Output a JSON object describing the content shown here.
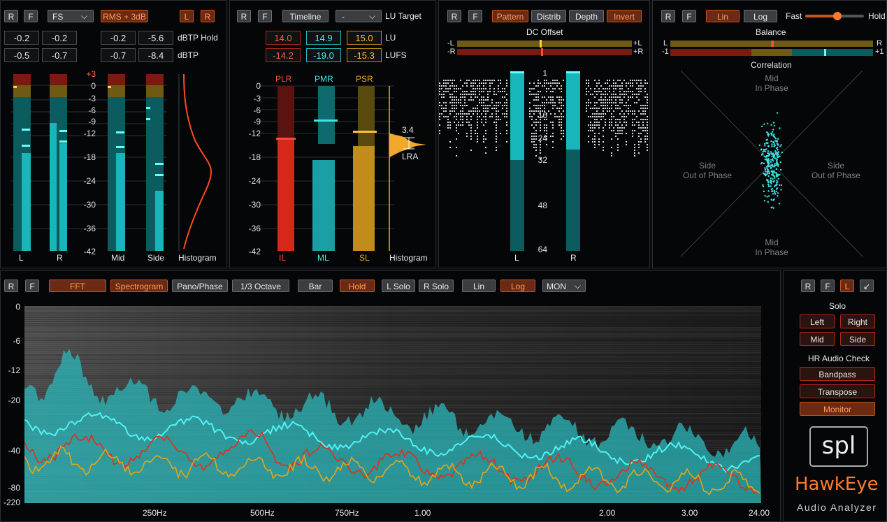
{
  "colors": {
    "accent": "#c4561f",
    "cyan": "#3fe5e6",
    "red": "#d7261a",
    "yellow": "#d69a14"
  },
  "p1": {
    "btn_r": "R",
    "btn_f": "F",
    "mode": "FS",
    "rms": "RMS + 3dB",
    "btn_l": "L",
    "btn_r2": "R",
    "hold_values": [
      "-0.2",
      "-0.2",
      "-0.2",
      "-5.6"
    ],
    "hold_label": "dBTP Hold",
    "dbtp_values": [
      "-0.5",
      "-0.7",
      "-0.7",
      "-8.4"
    ],
    "dbtp_label": "dBTP",
    "scale": [
      "+3",
      "0",
      "-3",
      "-6",
      "-9",
      "-12",
      "-18",
      "-24",
      "-30",
      "-36",
      "-42"
    ],
    "ch": [
      "L",
      "R",
      "Mid",
      "Side"
    ],
    "histogram": "Histogram"
  },
  "p2": {
    "btn_r": "R",
    "btn_f": "F",
    "timeline": "Timeline",
    "dash": "-",
    "lu_target": "LU Target",
    "lu_values": [
      "14.0",
      "14.9",
      "15.0"
    ],
    "lu_label": "LU",
    "lufs_values": [
      "-14.2",
      "-19.0",
      "-15.3"
    ],
    "lufs_label": "LUFS",
    "heads": [
      "PLR",
      "PMR",
      "PSR"
    ],
    "feet": [
      "IL",
      "ML",
      "SL"
    ],
    "scale": [
      "0",
      "-3",
      "-6",
      "-9",
      "-12",
      "-18",
      "-24",
      "-30",
      "-36",
      "-42"
    ],
    "lra_value": "3.4",
    "lra_label": "LRA",
    "histogram": "Histogram"
  },
  "p3": {
    "btn_r": "R",
    "btn_f": "F",
    "pattern": "Pattern",
    "distrib": "Distrib",
    "depth": "Depth",
    "invert": "Invert",
    "dc_title": "DC Offset",
    "dc_l": "-L",
    "dc_r": "-R",
    "dc_pl": "+L",
    "dc_pr": "+R",
    "scale": [
      "1",
      "16",
      "24",
      "32",
      "48",
      "64"
    ],
    "ch": [
      "L",
      "R"
    ]
  },
  "p4": {
    "btn_r": "R",
    "btn_f": "F",
    "lin": "Lin",
    "log": "Log",
    "fast": "Fast",
    "hold": "Hold",
    "slider_level": 0.55,
    "balance": "Balance",
    "bal_l": "L",
    "bal_r": "R",
    "corr_l": "-1",
    "corr_r": "+1",
    "correlation": "Correlation",
    "mid_top": "Mid",
    "in_phase_top": "In Phase",
    "side_left": "Side",
    "oop_left": "Out of Phase",
    "side_right": "Side",
    "oop_right": "Out of Phase",
    "mid_bottom": "Mid",
    "in_phase_bottom": "In Phase"
  },
  "p5": {
    "btn_r": "R",
    "btn_f": "F",
    "fft": "FFT",
    "spectrogram": "Spectrogram",
    "pano": "Pano/Phase",
    "octave": "1/3 Octave",
    "bar": "Bar",
    "hold": "Hold",
    "lsolo": "L Solo",
    "rsolo": "R Solo",
    "lin": "Lin",
    "log": "Log",
    "mon": "MON",
    "yticks": [
      "0",
      "-6",
      "-12",
      "-20",
      "-40",
      "-80",
      "-220"
    ],
    "xticks": [
      "250Hz",
      "500Hz",
      "750Hz",
      "1.00",
      "2.00",
      "3.00",
      "24.00"
    ]
  },
  "p6": {
    "btn_r": "R",
    "btn_f": "F",
    "btn_l": "L",
    "solo": "Solo",
    "left": "Left",
    "right": "Right",
    "mid": "Mid",
    "side": "Side",
    "hr": "HR Audio Check",
    "bandpass": "Bandpass",
    "transpose": "Transpose",
    "monitor": "Monitor",
    "logo": "spl",
    "brand": "HawkEye",
    "sub": "Audio Analyzer"
  }
}
